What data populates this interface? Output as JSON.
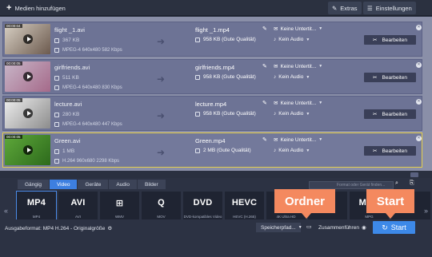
{
  "toolbar": {
    "add_media_label": "Medien hinzufügen",
    "extras_label": "Extras",
    "settings_label": "Einstellungen"
  },
  "files": [
    {
      "duration": "00:00:04",
      "source_name": "flight _1.avi",
      "source_size": "367 KB",
      "source_meta": "MPEG-4 640x480 582 Kbps",
      "output_name": "flight _1.mp4",
      "output_size": "958 KB (Gute Qualität)",
      "subtitle": "Keine Untertit...",
      "audio": "Kein Audio",
      "edit_label": "Bearbeiten",
      "thumb_colors": [
        "#d7cfc3",
        "#6c5a4e"
      ]
    },
    {
      "duration": "00:00:05",
      "source_name": "girlfriends.avi",
      "source_size": "511 KB",
      "source_meta": "MPEG-4 640x480 830 Kbps",
      "output_name": "girlfriends.mp4",
      "output_size": "958 KB (Gute Qualität)",
      "subtitle": "Keine Untertit...",
      "audio": "Kein Audio",
      "edit_label": "Bearbeiten",
      "thumb_colors": [
        "#c8b6c8",
        "#a56a8a"
      ]
    },
    {
      "duration": "00:00:05",
      "source_name": "lecture.avi",
      "source_size": "280 KB",
      "source_meta": "MPEG-4 640x480 447 Kbps",
      "output_name": "lecture.mp4",
      "output_size": "958 KB (Gute Qualität)",
      "subtitle": "Keine Untertit...",
      "audio": "Kein Audio",
      "edit_label": "Bearbeiten",
      "thumb_colors": [
        "#eeeeee",
        "#8c8c8c"
      ]
    },
    {
      "duration": "00:00:05",
      "source_name": "Green.avi",
      "source_size": "1 MB",
      "source_meta": "H.264 960x680 2298 Kbps",
      "output_name": "Green.mp4",
      "output_size": "2 MB (Gute Qualität)",
      "subtitle": "Keine Untertit...",
      "audio": "Kein Audio",
      "edit_label": "Bearbeiten",
      "thumb_colors": [
        "#5ea83a",
        "#2d6a1c"
      ]
    }
  ],
  "tabs": [
    "Gängig",
    "Video",
    "Geräte",
    "Audio",
    "Bilder"
  ],
  "active_tab": "Video",
  "format_search_placeholder": "Format oder Gerät finden...",
  "formats": [
    {
      "logo": "MP4",
      "label": "MP4"
    },
    {
      "logo": "AVI",
      "label": "AVI"
    },
    {
      "logo": "⊞",
      "label": "WMV"
    },
    {
      "logo": "Q",
      "label": "MOV"
    },
    {
      "logo": "DVD",
      "label": "DVD-kompatibles Video"
    },
    {
      "logo": "HEVC",
      "label": "HEVC (H.265)"
    },
    {
      "logo": "4K",
      "label": "4K Ultra HD"
    },
    {
      "logo": "",
      "label": ""
    },
    {
      "logo": "MPG",
      "label": "MPG"
    },
    {
      "logo": "",
      "label": ""
    }
  ],
  "bottom": {
    "output_format": "Ausgabeformat: MP4 H.264 - Originalgröße",
    "save_path_label": "Speicherpfad...",
    "merge_label": "Zusammenführen",
    "start_label": "Start"
  },
  "callouts": {
    "folder": "Ordner",
    "start": "Start"
  },
  "colors": {
    "accent": "#3d89e8",
    "callout": "#f4895f",
    "selection": "#e6cf4b"
  }
}
